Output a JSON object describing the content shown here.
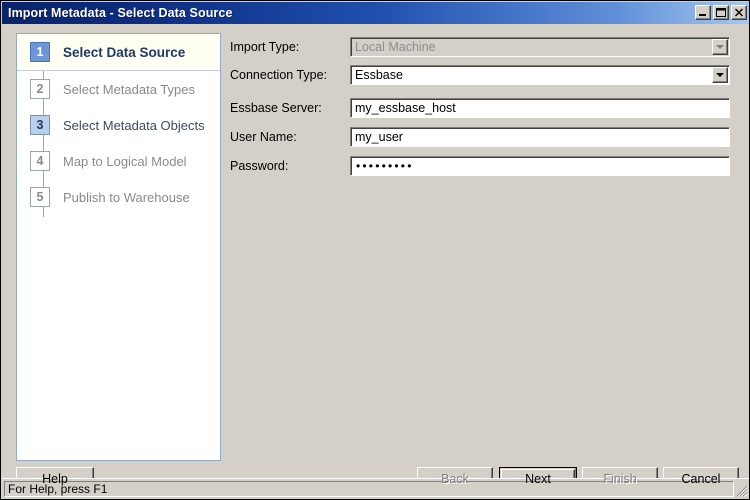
{
  "window": {
    "title": "Import Metadata - Select Data Source",
    "controls": [
      {
        "name": "minimize-button",
        "glyph": "minimize"
      },
      {
        "name": "maximize-button",
        "glyph": "maximize"
      },
      {
        "name": "close-button",
        "glyph": "close"
      }
    ]
  },
  "colors": {
    "titlebar_start": "#0a246a",
    "titlebar_end": "#a6c8ef",
    "dialog_face": "#d4d0c8",
    "panel_background": "#ffffff",
    "panel_border": "#93a9c4",
    "active_step_background": "#fffff4",
    "badge_current": "#6e96d6",
    "badge_visited": "#b6d0ee",
    "badge_pending": "#ffffff",
    "label_current": "#1f3864",
    "label_disabled": "#8a8a8a"
  },
  "steps": [
    {
      "number": "1",
      "label": "Select Data Source",
      "state": "current"
    },
    {
      "number": "2",
      "label": "Select Metadata Types",
      "state": "pending"
    },
    {
      "number": "3",
      "label": "Select Metadata Objects",
      "state": "visited"
    },
    {
      "number": "4",
      "label": "Map to Logical Model",
      "state": "pending"
    },
    {
      "number": "5",
      "label": "Publish to Warehouse",
      "state": "pending"
    }
  ],
  "form": {
    "import_type": {
      "label": "Import Type:",
      "value": "Local Machine",
      "type": "combobox",
      "enabled": false
    },
    "connection_type": {
      "label": "Connection Type:",
      "value": "Essbase",
      "type": "combobox",
      "enabled": true
    },
    "essbase_server": {
      "label": "Essbase Server:",
      "value": "my_essbase_host",
      "type": "text",
      "enabled": true
    },
    "user_name": {
      "label": "User Name:",
      "value": "my_user",
      "type": "text",
      "enabled": true
    },
    "password": {
      "label": "Password:",
      "value": "•••••••••",
      "type": "password",
      "enabled": true
    }
  },
  "buttons": {
    "help": {
      "label": "Help",
      "enabled": true,
      "default": false
    },
    "back": {
      "label": "Back",
      "enabled": false,
      "default": false
    },
    "next": {
      "label": "Next",
      "enabled": true,
      "default": true
    },
    "finish": {
      "label": "Finish",
      "enabled": false,
      "default": false
    },
    "cancel": {
      "label": "Cancel",
      "enabled": true,
      "default": false
    }
  },
  "statusbar": {
    "text": "For Help, press F1"
  }
}
